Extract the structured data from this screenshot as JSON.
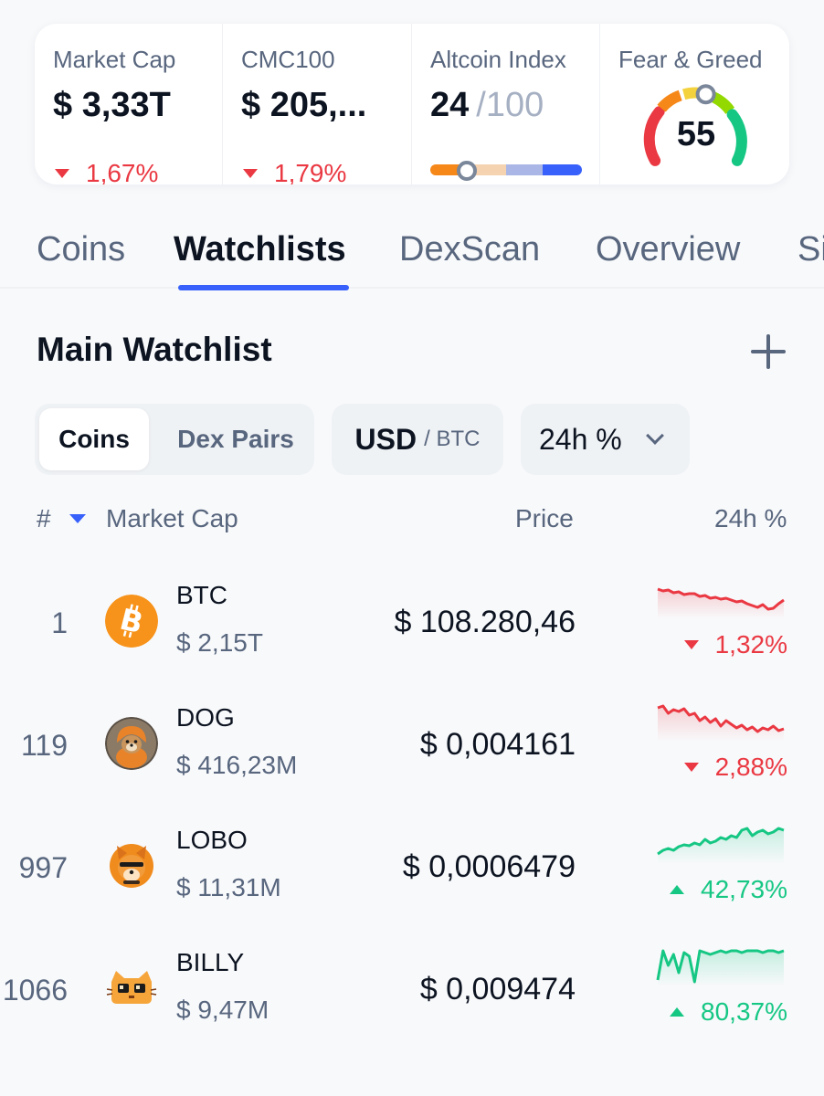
{
  "stats": {
    "market_cap": {
      "label": "Market Cap",
      "value": "$ 3,33T",
      "change": "1,67%"
    },
    "cmc100": {
      "label": "CMC100",
      "value": "$ 205,...",
      "change": "1,79%"
    },
    "altcoin": {
      "label": "Altcoin Index",
      "value": "24",
      "max": "/100",
      "level": 0.24
    },
    "fear_greed": {
      "label": "Fear & Greed",
      "value": "55",
      "level": 0.55
    }
  },
  "tabs": [
    "Coins",
    "Watchlists",
    "DexScan",
    "Overview",
    "Si"
  ],
  "watchlist": {
    "title": "Main Watchlist",
    "segment": {
      "active": "Coins",
      "inactive": "Dex Pairs"
    },
    "currency": {
      "primary": "USD",
      "secondary": "/ BTC"
    },
    "period": "24h %"
  },
  "table": {
    "headers": {
      "rank": "#",
      "market_cap": "Market Cap",
      "price": "Price",
      "change": "24h %"
    },
    "rows": [
      {
        "rank": "1",
        "symbol": "BTC",
        "market_cap": "$ 2,15T",
        "price": "$ 108.280,46",
        "change": "1,32%",
        "direction": "down",
        "logo": "bitcoin-logo",
        "spark": [
          12,
          14,
          13,
          16,
          15,
          18,
          17,
          17,
          20,
          19,
          22,
          21,
          23,
          22,
          24,
          26,
          25,
          28,
          30,
          32,
          29,
          34,
          33,
          28,
          24
        ]
      },
      {
        "rank": "119",
        "symbol": "DOG",
        "market_cap": "$ 416,23M",
        "price": "$ 0,004161",
        "change": "2,88%",
        "direction": "down",
        "logo": "dog-logo",
        "spark": [
          8,
          6,
          14,
          10,
          12,
          9,
          16,
          14,
          22,
          18,
          24,
          20,
          28,
          22,
          26,
          30,
          27,
          32,
          29,
          34,
          30,
          32,
          28,
          33,
          31
        ]
      },
      {
        "rank": "997",
        "symbol": "LOBO",
        "market_cap": "$ 11,31M",
        "price": "$ 0,0006479",
        "change": "42,73%",
        "direction": "up",
        "logo": "lobo-logo",
        "spark": [
          34,
          30,
          28,
          30,
          26,
          24,
          25,
          22,
          24,
          18,
          22,
          20,
          16,
          18,
          14,
          16,
          8,
          6,
          14,
          10,
          8,
          12,
          10,
          6,
          8
        ]
      },
      {
        "rank": "1066",
        "symbol": "BILLY",
        "market_cap": "$ 9,47M",
        "price": "$ 0,009474",
        "change": "80,37%",
        "direction": "up",
        "logo": "billy-logo",
        "spark": [
          38,
          6,
          22,
          10,
          30,
          8,
          12,
          40,
          6,
          8,
          10,
          8,
          6,
          8,
          6,
          6,
          8,
          6,
          6,
          6,
          8,
          6,
          6,
          8,
          6
        ]
      }
    ]
  },
  "colors": {
    "red": "#ea3943",
    "green": "#16c784",
    "blue": "#3861fb"
  }
}
